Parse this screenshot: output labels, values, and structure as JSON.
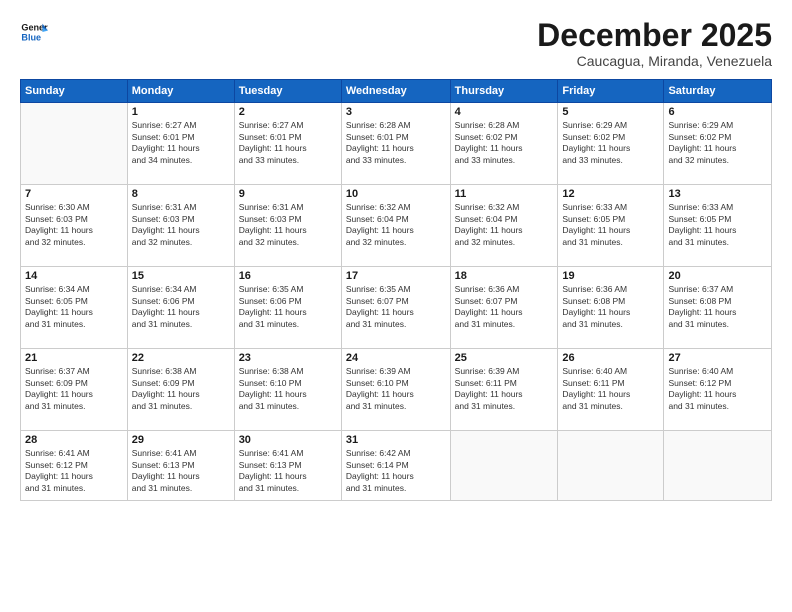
{
  "logo": {
    "line1": "General",
    "line2": "Blue"
  },
  "header": {
    "title": "December 2025",
    "subtitle": "Caucagua, Miranda, Venezuela"
  },
  "days_of_week": [
    "Sunday",
    "Monday",
    "Tuesday",
    "Wednesday",
    "Thursday",
    "Friday",
    "Saturday"
  ],
  "weeks": [
    [
      {
        "day": "",
        "info": ""
      },
      {
        "day": "1",
        "info": "Sunrise: 6:27 AM\nSunset: 6:01 PM\nDaylight: 11 hours\nand 34 minutes."
      },
      {
        "day": "2",
        "info": "Sunrise: 6:27 AM\nSunset: 6:01 PM\nDaylight: 11 hours\nand 33 minutes."
      },
      {
        "day": "3",
        "info": "Sunrise: 6:28 AM\nSunset: 6:01 PM\nDaylight: 11 hours\nand 33 minutes."
      },
      {
        "day": "4",
        "info": "Sunrise: 6:28 AM\nSunset: 6:02 PM\nDaylight: 11 hours\nand 33 minutes."
      },
      {
        "day": "5",
        "info": "Sunrise: 6:29 AM\nSunset: 6:02 PM\nDaylight: 11 hours\nand 33 minutes."
      },
      {
        "day": "6",
        "info": "Sunrise: 6:29 AM\nSunset: 6:02 PM\nDaylight: 11 hours\nand 32 minutes."
      }
    ],
    [
      {
        "day": "7",
        "info": "Sunrise: 6:30 AM\nSunset: 6:03 PM\nDaylight: 11 hours\nand 32 minutes."
      },
      {
        "day": "8",
        "info": "Sunrise: 6:31 AM\nSunset: 6:03 PM\nDaylight: 11 hours\nand 32 minutes."
      },
      {
        "day": "9",
        "info": "Sunrise: 6:31 AM\nSunset: 6:03 PM\nDaylight: 11 hours\nand 32 minutes."
      },
      {
        "day": "10",
        "info": "Sunrise: 6:32 AM\nSunset: 6:04 PM\nDaylight: 11 hours\nand 32 minutes."
      },
      {
        "day": "11",
        "info": "Sunrise: 6:32 AM\nSunset: 6:04 PM\nDaylight: 11 hours\nand 32 minutes."
      },
      {
        "day": "12",
        "info": "Sunrise: 6:33 AM\nSunset: 6:05 PM\nDaylight: 11 hours\nand 31 minutes."
      },
      {
        "day": "13",
        "info": "Sunrise: 6:33 AM\nSunset: 6:05 PM\nDaylight: 11 hours\nand 31 minutes."
      }
    ],
    [
      {
        "day": "14",
        "info": "Sunrise: 6:34 AM\nSunset: 6:05 PM\nDaylight: 11 hours\nand 31 minutes."
      },
      {
        "day": "15",
        "info": "Sunrise: 6:34 AM\nSunset: 6:06 PM\nDaylight: 11 hours\nand 31 minutes."
      },
      {
        "day": "16",
        "info": "Sunrise: 6:35 AM\nSunset: 6:06 PM\nDaylight: 11 hours\nand 31 minutes."
      },
      {
        "day": "17",
        "info": "Sunrise: 6:35 AM\nSunset: 6:07 PM\nDaylight: 11 hours\nand 31 minutes."
      },
      {
        "day": "18",
        "info": "Sunrise: 6:36 AM\nSunset: 6:07 PM\nDaylight: 11 hours\nand 31 minutes."
      },
      {
        "day": "19",
        "info": "Sunrise: 6:36 AM\nSunset: 6:08 PM\nDaylight: 11 hours\nand 31 minutes."
      },
      {
        "day": "20",
        "info": "Sunrise: 6:37 AM\nSunset: 6:08 PM\nDaylight: 11 hours\nand 31 minutes."
      }
    ],
    [
      {
        "day": "21",
        "info": "Sunrise: 6:37 AM\nSunset: 6:09 PM\nDaylight: 11 hours\nand 31 minutes."
      },
      {
        "day": "22",
        "info": "Sunrise: 6:38 AM\nSunset: 6:09 PM\nDaylight: 11 hours\nand 31 minutes."
      },
      {
        "day": "23",
        "info": "Sunrise: 6:38 AM\nSunset: 6:10 PM\nDaylight: 11 hours\nand 31 minutes."
      },
      {
        "day": "24",
        "info": "Sunrise: 6:39 AM\nSunset: 6:10 PM\nDaylight: 11 hours\nand 31 minutes."
      },
      {
        "day": "25",
        "info": "Sunrise: 6:39 AM\nSunset: 6:11 PM\nDaylight: 11 hours\nand 31 minutes."
      },
      {
        "day": "26",
        "info": "Sunrise: 6:40 AM\nSunset: 6:11 PM\nDaylight: 11 hours\nand 31 minutes."
      },
      {
        "day": "27",
        "info": "Sunrise: 6:40 AM\nSunset: 6:12 PM\nDaylight: 11 hours\nand 31 minutes."
      }
    ],
    [
      {
        "day": "28",
        "info": "Sunrise: 6:41 AM\nSunset: 6:12 PM\nDaylight: 11 hours\nand 31 minutes."
      },
      {
        "day": "29",
        "info": "Sunrise: 6:41 AM\nSunset: 6:13 PM\nDaylight: 11 hours\nand 31 minutes."
      },
      {
        "day": "30",
        "info": "Sunrise: 6:41 AM\nSunset: 6:13 PM\nDaylight: 11 hours\nand 31 minutes."
      },
      {
        "day": "31",
        "info": "Sunrise: 6:42 AM\nSunset: 6:14 PM\nDaylight: 11 hours\nand 31 minutes."
      },
      {
        "day": "",
        "info": ""
      },
      {
        "day": "",
        "info": ""
      },
      {
        "day": "",
        "info": ""
      }
    ]
  ]
}
